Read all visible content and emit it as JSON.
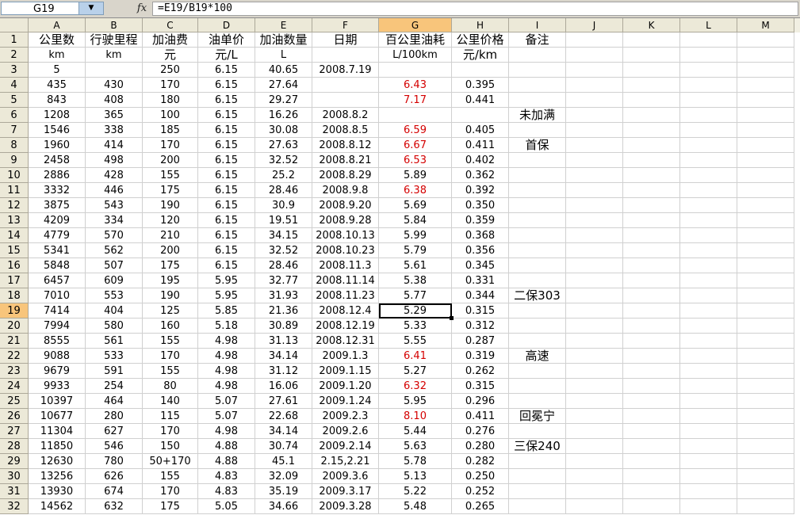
{
  "formula_bar": {
    "name_box": "G19",
    "fx_label": "fx",
    "formula": "=E19/B19*100"
  },
  "columns": [
    "A",
    "B",
    "C",
    "D",
    "E",
    "F",
    "G",
    "H",
    "I",
    "J",
    "K",
    "L",
    "M"
  ],
  "selected_column": "G",
  "selected_row": "19",
  "rows": [
    {
      "n": "1",
      "cells": [
        "公里数",
        "行驶里程",
        "加油费",
        "油单价",
        "加油数量",
        "日期",
        "百公里油耗",
        "公里价格",
        "备注",
        "",
        "",
        "",
        ""
      ]
    },
    {
      "n": "2",
      "cells": [
        "km",
        "km",
        "元",
        "元/L",
        "L",
        "",
        "L/100km",
        "元/km",
        "",
        "",
        "",
        "",
        ""
      ]
    },
    {
      "n": "3",
      "cells": [
        "5",
        "",
        "250",
        "6.15",
        "40.65",
        "2008.7.19",
        "",
        "",
        "",
        "",
        "",
        "",
        ""
      ]
    },
    {
      "n": "4",
      "cells": [
        "435",
        "430",
        "170",
        "6.15",
        "27.64",
        "",
        "6.43",
        "0.395",
        "",
        "",
        "",
        "",
        ""
      ]
    },
    {
      "n": "5",
      "cells": [
        "843",
        "408",
        "180",
        "6.15",
        "29.27",
        "",
        "7.17",
        "0.441",
        "",
        "",
        "",
        "",
        ""
      ]
    },
    {
      "n": "6",
      "cells": [
        "1208",
        "365",
        "100",
        "6.15",
        "16.26",
        "2008.8.2",
        "",
        "",
        "未加满",
        "",
        "",
        "",
        ""
      ]
    },
    {
      "n": "7",
      "cells": [
        "1546",
        "338",
        "185",
        "6.15",
        "30.08",
        "2008.8.5",
        "6.59",
        "0.405",
        "",
        "",
        "",
        "",
        ""
      ]
    },
    {
      "n": "8",
      "cells": [
        "1960",
        "414",
        "170",
        "6.15",
        "27.63",
        "2008.8.12",
        "6.67",
        "0.411",
        "首保",
        "",
        "",
        "",
        ""
      ]
    },
    {
      "n": "9",
      "cells": [
        "2458",
        "498",
        "200",
        "6.15",
        "32.52",
        "2008.8.21",
        "6.53",
        "0.402",
        "",
        "",
        "",
        "",
        ""
      ]
    },
    {
      "n": "10",
      "cells": [
        "2886",
        "428",
        "155",
        "6.15",
        "25.2",
        "2008.8.29",
        "5.89",
        "0.362",
        "",
        "",
        "",
        "",
        ""
      ]
    },
    {
      "n": "11",
      "cells": [
        "3332",
        "446",
        "175",
        "6.15",
        "28.46",
        "2008.9.8",
        "6.38",
        "0.392",
        "",
        "",
        "",
        "",
        ""
      ]
    },
    {
      "n": "12",
      "cells": [
        "3875",
        "543",
        "190",
        "6.15",
        "30.9",
        "2008.9.20",
        "5.69",
        "0.350",
        "",
        "",
        "",
        "",
        ""
      ]
    },
    {
      "n": "13",
      "cells": [
        "4209",
        "334",
        "120",
        "6.15",
        "19.51",
        "2008.9.28",
        "5.84",
        "0.359",
        "",
        "",
        "",
        "",
        ""
      ]
    },
    {
      "n": "14",
      "cells": [
        "4779",
        "570",
        "210",
        "6.15",
        "34.15",
        "2008.10.13",
        "5.99",
        "0.368",
        "",
        "",
        "",
        "",
        ""
      ]
    },
    {
      "n": "15",
      "cells": [
        "5341",
        "562",
        "200",
        "6.15",
        "32.52",
        "2008.10.23",
        "5.79",
        "0.356",
        "",
        "",
        "",
        "",
        ""
      ]
    },
    {
      "n": "16",
      "cells": [
        "5848",
        "507",
        "175",
        "6.15",
        "28.46",
        "2008.11.3",
        "5.61",
        "0.345",
        "",
        "",
        "",
        "",
        ""
      ]
    },
    {
      "n": "17",
      "cells": [
        "6457",
        "609",
        "195",
        "5.95",
        "32.77",
        "2008.11.14",
        "5.38",
        "0.331",
        "",
        "",
        "",
        "",
        ""
      ]
    },
    {
      "n": "18",
      "cells": [
        "7010",
        "553",
        "190",
        "5.95",
        "31.93",
        "2008.11.23",
        "5.77",
        "0.344",
        "二保303",
        "",
        "",
        "",
        ""
      ]
    },
    {
      "n": "19",
      "cells": [
        "7414",
        "404",
        "125",
        "5.85",
        "21.36",
        "2008.12.4",
        "5.29",
        "0.315",
        "",
        "",
        "",
        "",
        ""
      ]
    },
    {
      "n": "20",
      "cells": [
        "7994",
        "580",
        "160",
        "5.18",
        "30.89",
        "2008.12.19",
        "5.33",
        "0.312",
        "",
        "",
        "",
        "",
        ""
      ]
    },
    {
      "n": "21",
      "cells": [
        "8555",
        "561",
        "155",
        "4.98",
        "31.13",
        "2008.12.31",
        "5.55",
        "0.287",
        "",
        "",
        "",
        "",
        ""
      ]
    },
    {
      "n": "22",
      "cells": [
        "9088",
        "533",
        "170",
        "4.98",
        "34.14",
        "2009.1.3",
        "6.41",
        "0.319",
        "高速",
        "",
        "",
        "",
        ""
      ]
    },
    {
      "n": "23",
      "cells": [
        "9679",
        "591",
        "155",
        "4.98",
        "31.12",
        "2009.1.15",
        "5.27",
        "0.262",
        "",
        "",
        "",
        "",
        ""
      ]
    },
    {
      "n": "24",
      "cells": [
        "9933",
        "254",
        "80",
        "4.98",
        "16.06",
        "2009.1.20",
        "6.32",
        "0.315",
        "",
        "",
        "",
        "",
        ""
      ]
    },
    {
      "n": "25",
      "cells": [
        "10397",
        "464",
        "140",
        "5.07",
        "27.61",
        "2009.1.24",
        "5.95",
        "0.296",
        "",
        "",
        "",
        "",
        ""
      ]
    },
    {
      "n": "26",
      "cells": [
        "10677",
        "280",
        "115",
        "5.07",
        "22.68",
        "2009.2.3",
        "8.10",
        "0.411",
        "回冕宁",
        "",
        "",
        "",
        ""
      ]
    },
    {
      "n": "27",
      "cells": [
        "11304",
        "627",
        "170",
        "4.98",
        "34.14",
        "2009.2.6",
        "5.44",
        "0.276",
        "",
        "",
        "",
        "",
        ""
      ]
    },
    {
      "n": "28",
      "cells": [
        "11850",
        "546",
        "150",
        "4.88",
        "30.74",
        "2009.2.14",
        "5.63",
        "0.280",
        "三保240",
        "",
        "",
        "",
        ""
      ]
    },
    {
      "n": "29",
      "cells": [
        "12630",
        "780",
        "50+170",
        "4.88",
        "45.1",
        "2.15,2.21",
        "5.78",
        "0.282",
        "",
        "",
        "",
        "",
        ""
      ]
    },
    {
      "n": "30",
      "cells": [
        "13256",
        "626",
        "155",
        "4.83",
        "32.09",
        "2009.3.6",
        "5.13",
        "0.250",
        "",
        "",
        "",
        "",
        ""
      ]
    },
    {
      "n": "31",
      "cells": [
        "13930",
        "674",
        "170",
        "4.83",
        "35.19",
        "2009.3.17",
        "5.22",
        "0.252",
        "",
        "",
        "",
        "",
        ""
      ]
    },
    {
      "n": "32",
      "cells": [
        "14562",
        "632",
        "175",
        "5.05",
        "34.66",
        "2009.3.28",
        "5.48",
        "0.265",
        "",
        "",
        "",
        "",
        ""
      ]
    }
  ],
  "red_cells": [
    "G4",
    "G5",
    "G7",
    "G8",
    "G9",
    "G11",
    "G22",
    "G24",
    "G26"
  ],
  "colors": {
    "header_bg": "#ece9d8",
    "selected_header": "#f8c57b",
    "red_text": "#d40000",
    "gridline": "#d0d0d0"
  }
}
